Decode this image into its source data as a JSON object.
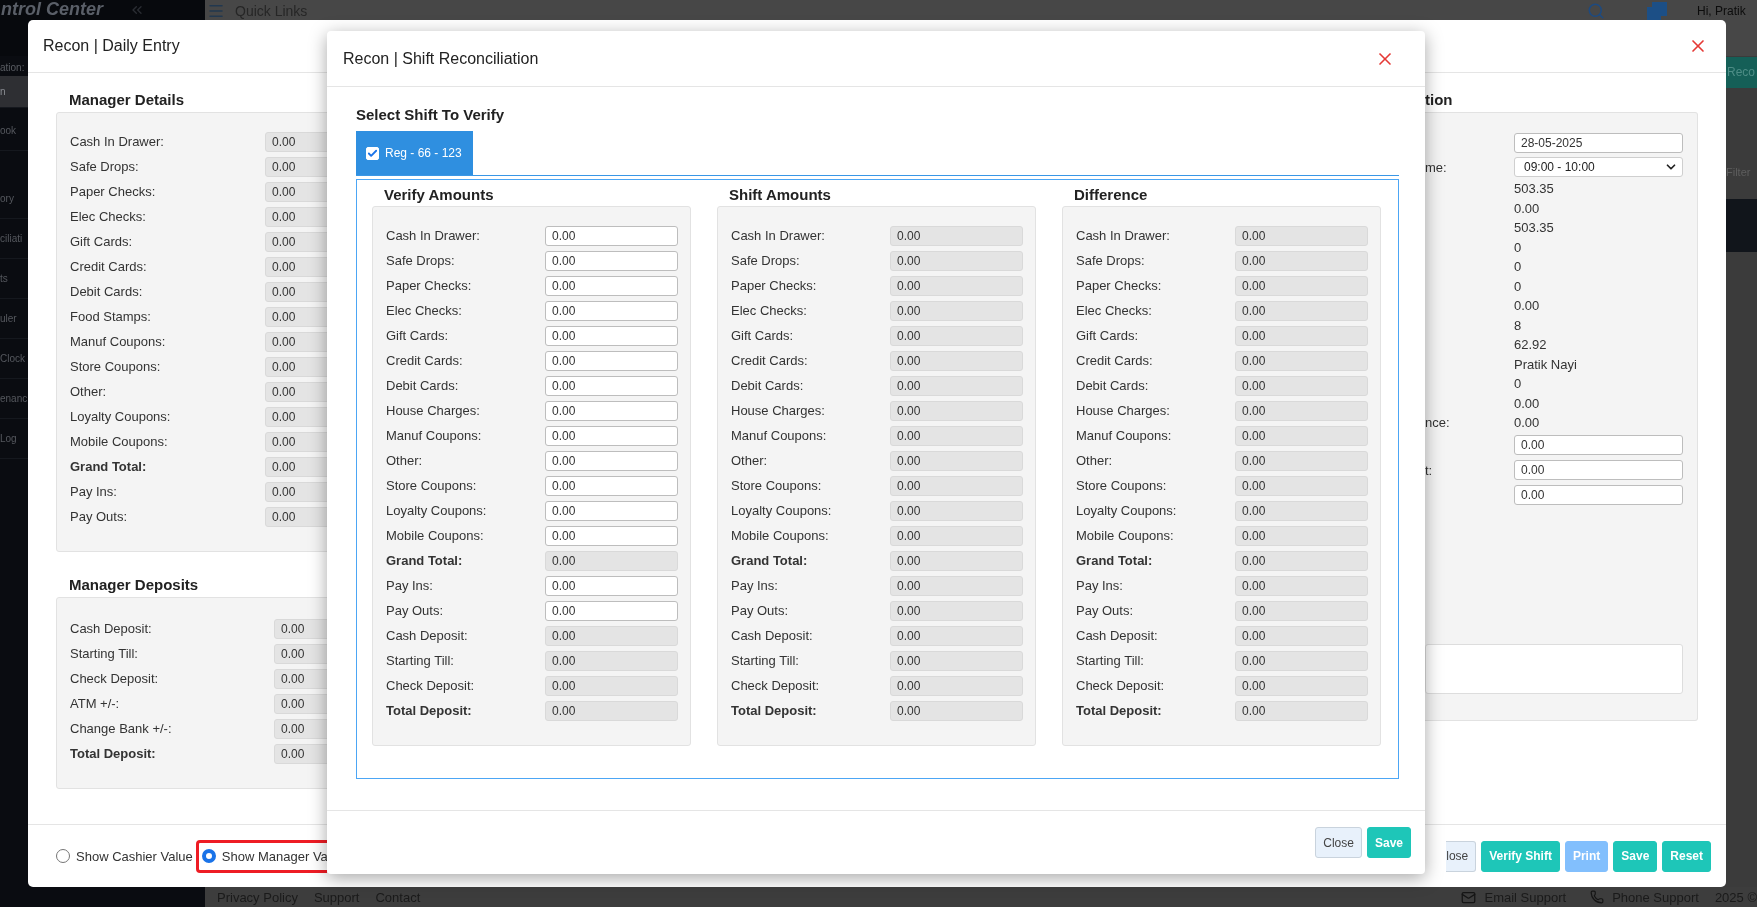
{
  "background": {
    "brand": "ntrol Center",
    "quick_links": "Quick Links",
    "user_greeting": "Hi, Pratik",
    "sidebar_caption": "ation:",
    "sidebar_items": [
      {
        "label": "n",
        "selected": true
      },
      {
        "label": "ook",
        "selected": false
      },
      {
        "label": "ory",
        "selected": false
      },
      {
        "label": "ciliati",
        "selected": false
      },
      {
        "label": "ts",
        "selected": false
      },
      {
        "label": "uler",
        "selected": false
      },
      {
        "label": "Clock",
        "selected": false
      },
      {
        "label": "enanc",
        "selected": false
      },
      {
        "label": "Log",
        "selected": false
      }
    ],
    "report_button": "Reco",
    "filter_label": "Filter",
    "footer_links": [
      "Privacy Policy",
      "Support",
      "Contact"
    ],
    "email_support": "Email Support",
    "phone_support": "Phone Support",
    "copyright": "2025 ©"
  },
  "daily_entry": {
    "title": "Recon | Daily Entry",
    "manager_details": {
      "heading": "Manager Details",
      "rows": [
        {
          "label": "Cash In Drawer:",
          "value": "0.00",
          "bold": false
        },
        {
          "label": "Safe Drops:",
          "value": "0.00",
          "bold": false
        },
        {
          "label": "Paper Checks:",
          "value": "0.00",
          "bold": false
        },
        {
          "label": "Elec Checks:",
          "value": "0.00",
          "bold": false
        },
        {
          "label": "Gift Cards:",
          "value": "0.00",
          "bold": false
        },
        {
          "label": "Credit Cards:",
          "value": "0.00",
          "bold": false
        },
        {
          "label": "Debit Cards:",
          "value": "0.00",
          "bold": false
        },
        {
          "label": "Food Stamps:",
          "value": "0.00",
          "bold": false
        },
        {
          "label": "Manuf Coupons:",
          "value": "0.00",
          "bold": false
        },
        {
          "label": "Store Coupons:",
          "value": "0.00",
          "bold": false
        },
        {
          "label": "Other:",
          "value": "0.00",
          "bold": false
        },
        {
          "label": "Loyalty Coupons:",
          "value": "0.00",
          "bold": false
        },
        {
          "label": "Mobile Coupons:",
          "value": "0.00",
          "bold": false
        },
        {
          "label": "Grand Total:",
          "value": "0.00",
          "bold": true
        },
        {
          "label": "Pay Ins:",
          "value": "0.00",
          "bold": false
        },
        {
          "label": "Pay Outs:",
          "value": "0.00",
          "bold": false
        }
      ]
    },
    "manager_deposits": {
      "heading": "Manager Deposits",
      "rows": [
        {
          "label": "Cash Deposit:",
          "value": "0.00",
          "bold": false
        },
        {
          "label": "Starting Till:",
          "value": "0.00",
          "bold": false
        },
        {
          "label": "Check Deposit:",
          "value": "0.00",
          "bold": false
        },
        {
          "label": "ATM +/-:",
          "value": "0.00",
          "bold": false
        },
        {
          "label": "Change Bank +/-:",
          "value": "0.00",
          "bold": false
        },
        {
          "label": "Total Deposit:",
          "value": "0.00",
          "bold": true
        }
      ]
    },
    "information": {
      "heading": "tion",
      "rows": [
        {
          "kind": "date",
          "value": "28-05-2025"
        },
        {
          "kind": "select",
          "label": "me:",
          "value": "09:00 - 10:00"
        },
        {
          "kind": "text",
          "value": "503.35"
        },
        {
          "kind": "text",
          "value": "0.00"
        },
        {
          "kind": "text",
          "value": "503.35"
        },
        {
          "kind": "text",
          "value": "0"
        },
        {
          "kind": "text",
          "value": "0"
        },
        {
          "kind": "text",
          "value": "0"
        },
        {
          "kind": "text",
          "value": "0.00"
        },
        {
          "kind": "text",
          "value": "8"
        },
        {
          "kind": "text",
          "value": "62.92"
        },
        {
          "kind": "text",
          "value": "Pratik Nayi"
        },
        {
          "kind": "text",
          "value": "0"
        },
        {
          "kind": "text",
          "value": "0.00"
        },
        {
          "kind": "text",
          "label": "nce:",
          "value": "0.00"
        },
        {
          "kind": "input",
          "value": "0.00"
        },
        {
          "kind": "input",
          "label": "t:",
          "value": "0.00"
        },
        {
          "kind": "input",
          "value": "0.00"
        }
      ]
    },
    "view_options": [
      {
        "label": "Show Cashier Value",
        "selected": false,
        "highlighted": false
      },
      {
        "label": "Show Manager Va",
        "selected": true,
        "highlighted": true
      }
    ],
    "buttons": [
      {
        "label": "lose",
        "kind": "light"
      },
      {
        "label": "Verify Shift",
        "kind": "primary"
      },
      {
        "label": "Print",
        "kind": "disabled"
      },
      {
        "label": "Save",
        "kind": "primary"
      },
      {
        "label": "Reset",
        "kind": "primary"
      }
    ]
  },
  "shift_reconciliation": {
    "title": "Recon | Shift Reconciliation",
    "select_label": "Select Shift To Verify",
    "shifts": [
      {
        "label": "Reg - 66 - 123",
        "checked": true,
        "selected": true
      }
    ],
    "columns": [
      {
        "heading": "Verify Amounts",
        "rows": [
          {
            "label": "Cash In Drawer:",
            "value": "0.00",
            "bold": false,
            "disabled": false
          },
          {
            "label": "Safe Drops:",
            "value": "0.00",
            "bold": false,
            "disabled": false
          },
          {
            "label": "Paper Checks:",
            "value": "0.00",
            "bold": false,
            "disabled": false
          },
          {
            "label": "Elec Checks:",
            "value": "0.00",
            "bold": false,
            "disabled": false
          },
          {
            "label": "Gift Cards:",
            "value": "0.00",
            "bold": false,
            "disabled": false
          },
          {
            "label": "Credit Cards:",
            "value": "0.00",
            "bold": false,
            "disabled": false
          },
          {
            "label": "Debit Cards:",
            "value": "0.00",
            "bold": false,
            "disabled": false
          },
          {
            "label": "House Charges:",
            "value": "0.00",
            "bold": false,
            "disabled": false
          },
          {
            "label": "Manuf Coupons:",
            "value": "0.00",
            "bold": false,
            "disabled": false
          },
          {
            "label": "Other:",
            "value": "0.00",
            "bold": false,
            "disabled": false
          },
          {
            "label": "Store Coupons:",
            "value": "0.00",
            "bold": false,
            "disabled": false
          },
          {
            "label": "Loyalty Coupons:",
            "value": "0.00",
            "bold": false,
            "disabled": false
          },
          {
            "label": "Mobile Coupons:",
            "value": "0.00",
            "bold": false,
            "disabled": false
          },
          {
            "label": "Grand Total:",
            "value": "0.00",
            "bold": true,
            "disabled": true
          },
          {
            "label": "Pay Ins:",
            "value": "0.00",
            "bold": false,
            "disabled": false
          },
          {
            "label": "Pay Outs:",
            "value": "0.00",
            "bold": false,
            "disabled": false
          },
          {
            "label": "Cash Deposit:",
            "value": "0.00",
            "bold": false,
            "disabled": true
          },
          {
            "label": "Starting Till:",
            "value": "0.00",
            "bold": false,
            "disabled": true
          },
          {
            "label": "Check Deposit:",
            "value": "0.00",
            "bold": false,
            "disabled": true
          },
          {
            "label": "Total Deposit:",
            "value": "0.00",
            "bold": true,
            "disabled": true
          }
        ]
      },
      {
        "heading": "Shift Amounts",
        "rows": [
          {
            "label": "Cash In Drawer:",
            "value": "0.00",
            "bold": false,
            "disabled": true
          },
          {
            "label": "Safe Drops:",
            "value": "0.00",
            "bold": false,
            "disabled": true
          },
          {
            "label": "Paper Checks:",
            "value": "0.00",
            "bold": false,
            "disabled": true
          },
          {
            "label": "Elec Checks:",
            "value": "0.00",
            "bold": false,
            "disabled": true
          },
          {
            "label": "Gift Cards:",
            "value": "0.00",
            "bold": false,
            "disabled": true
          },
          {
            "label": "Credit Cards:",
            "value": "0.00",
            "bold": false,
            "disabled": true
          },
          {
            "label": "Debit Cards:",
            "value": "0.00",
            "bold": false,
            "disabled": true
          },
          {
            "label": "House Charges:",
            "value": "0.00",
            "bold": false,
            "disabled": true
          },
          {
            "label": "Manuf Coupons:",
            "value": "0.00",
            "bold": false,
            "disabled": true
          },
          {
            "label": "Other:",
            "value": "0.00",
            "bold": false,
            "disabled": true
          },
          {
            "label": "Store Coupons:",
            "value": "0.00",
            "bold": false,
            "disabled": true
          },
          {
            "label": "Loyalty Coupons:",
            "value": "0.00",
            "bold": false,
            "disabled": true
          },
          {
            "label": "Mobile Coupons:",
            "value": "0.00",
            "bold": false,
            "disabled": true
          },
          {
            "label": "Grand Total:",
            "value": "0.00",
            "bold": true,
            "disabled": true
          },
          {
            "label": "Pay Ins:",
            "value": "0.00",
            "bold": false,
            "disabled": true
          },
          {
            "label": "Pay Outs:",
            "value": "0.00",
            "bold": false,
            "disabled": true
          },
          {
            "label": "Cash Deposit:",
            "value": "0.00",
            "bold": false,
            "disabled": true
          },
          {
            "label": "Starting Till:",
            "value": "0.00",
            "bold": false,
            "disabled": true
          },
          {
            "label": "Check Deposit:",
            "value": "0.00",
            "bold": false,
            "disabled": true
          },
          {
            "label": "Total Deposit:",
            "value": "0.00",
            "bold": true,
            "disabled": true
          }
        ]
      },
      {
        "heading": "Difference",
        "rows": [
          {
            "label": "Cash In Drawer:",
            "value": "0.00",
            "bold": false,
            "disabled": true
          },
          {
            "label": "Safe Drops:",
            "value": "0.00",
            "bold": false,
            "disabled": true
          },
          {
            "label": "Paper Checks:",
            "value": "0.00",
            "bold": false,
            "disabled": true
          },
          {
            "label": "Elec Checks:",
            "value": "0.00",
            "bold": false,
            "disabled": true
          },
          {
            "label": "Gift Cards:",
            "value": "0.00",
            "bold": false,
            "disabled": true
          },
          {
            "label": "Credit Cards:",
            "value": "0.00",
            "bold": false,
            "disabled": true
          },
          {
            "label": "Debit Cards:",
            "value": "0.00",
            "bold": false,
            "disabled": true
          },
          {
            "label": "House Charges:",
            "value": "0.00",
            "bold": false,
            "disabled": true
          },
          {
            "label": "Manuf Coupons:",
            "value": "0.00",
            "bold": false,
            "disabled": true
          },
          {
            "label": "Other:",
            "value": "0.00",
            "bold": false,
            "disabled": true
          },
          {
            "label": "Store Coupons:",
            "value": "0.00",
            "bold": false,
            "disabled": true
          },
          {
            "label": "Loyalty Coupons:",
            "value": "0.00",
            "bold": false,
            "disabled": true
          },
          {
            "label": "Mobile Coupons:",
            "value": "0.00",
            "bold": false,
            "disabled": true
          },
          {
            "label": "Grand Total:",
            "value": "0.00",
            "bold": true,
            "disabled": true
          },
          {
            "label": "Pay Ins:",
            "value": "0.00",
            "bold": false,
            "disabled": true
          },
          {
            "label": "Pay Outs:",
            "value": "0.00",
            "bold": false,
            "disabled": true
          },
          {
            "label": "Cash Deposit:",
            "value": "0.00",
            "bold": false,
            "disabled": true
          },
          {
            "label": "Starting Till:",
            "value": "0.00",
            "bold": false,
            "disabled": true
          },
          {
            "label": "Check Deposit:",
            "value": "0.00",
            "bold": false,
            "disabled": true
          },
          {
            "label": "Total Deposit:",
            "value": "0.00",
            "bold": true,
            "disabled": true
          }
        ]
      }
    ],
    "buttons": [
      {
        "label": "Close",
        "kind": "light"
      },
      {
        "label": "Save",
        "kind": "primary"
      }
    ]
  }
}
